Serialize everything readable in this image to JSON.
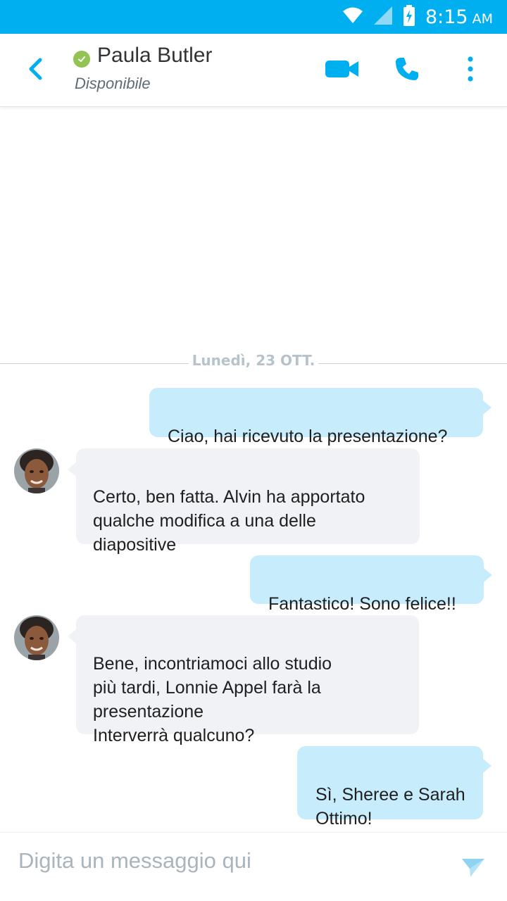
{
  "status_bar": {
    "time": "8:15",
    "ampm": "AM",
    "icons": [
      "wifi-icon",
      "signal-icon",
      "battery-charging-icon"
    ]
  },
  "header": {
    "contact_name": "Paula Butler",
    "contact_status": "Disponibile",
    "presence_color": "#92c353",
    "icons": [
      "back-chevron-icon",
      "video-call-icon",
      "phone-icon",
      "more-vertical-icon"
    ]
  },
  "conversation": {
    "date_separator": "Lunedì, 23 OTT.",
    "messages": [
      {
        "direction": "outgoing",
        "text": "Ciao, hai ricevuto la presentazione?"
      },
      {
        "direction": "incoming",
        "text": "Certo, ben fatta. Alvin ha apportato\nqualche modifica a una delle\ndiapositive"
      },
      {
        "direction": "outgoing",
        "text": "Fantastico! Sono felice!!"
      },
      {
        "direction": "incoming",
        "text": "Bene, incontriamoci allo studio\npiù tardi, Lonnie Appel farà la\npresentazione\nInterverrà qualcuno?"
      },
      {
        "direction": "outgoing",
        "text": "Sì, Sheree e Sarah\nOttimo!"
      }
    ]
  },
  "composer": {
    "placeholder": "Digita un messaggio qui",
    "send_icon": "send-icon"
  },
  "colors": {
    "accent": "#00aff0",
    "outgoing_bubble": "#c7ecfc",
    "incoming_bubble": "#f1f2f6"
  }
}
